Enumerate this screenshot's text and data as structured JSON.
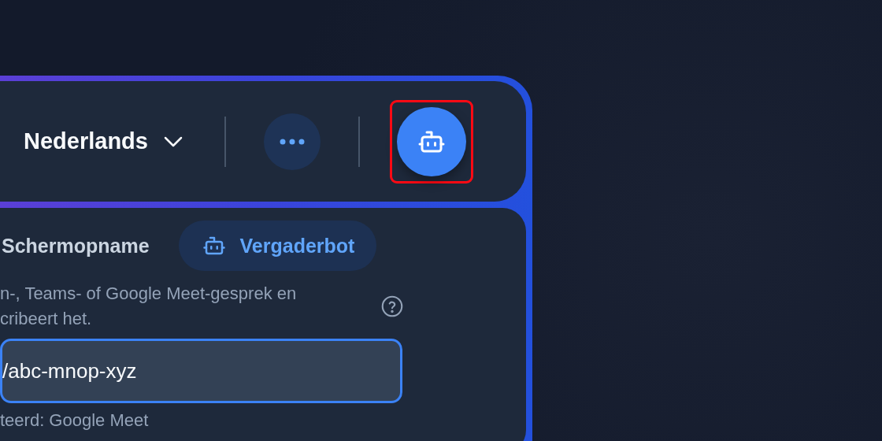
{
  "toolbar": {
    "language_selector": {
      "label": "Nederlands"
    },
    "bot_button": {
      "highlighted": true
    }
  },
  "modes": [
    {
      "label": "Schermopname",
      "selected": false,
      "kind": "screen"
    },
    {
      "label": "Vergaderbot",
      "selected": true,
      "kind": "bot"
    }
  ],
  "description_lines": [
    "n-, Teams- of Google Meet-gesprek en",
    "cribeert het."
  ],
  "meeting_link": {
    "value": "/abc-mnop-xyz",
    "focused": true
  },
  "detected_platform": "teerd: Google Meet"
}
